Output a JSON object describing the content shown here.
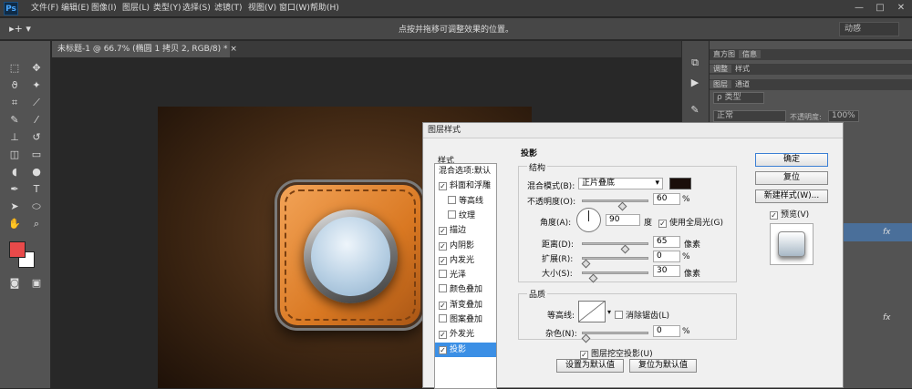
{
  "app": {
    "logo": "Ps"
  },
  "menubar": {
    "items": [
      "文件(F)",
      "编辑(E)",
      "图像(I)",
      "图层(L)",
      "类型(Y)",
      "选择(S)",
      "滤镜(T)",
      "视图(V)",
      "窗口(W)",
      "帮助(H)"
    ]
  },
  "window_controls": {
    "minimize": "—",
    "maximize": "□",
    "close": "✕"
  },
  "options_bar": {
    "hint": "点按并拖移可调整效果的位置。",
    "workspace": "动感"
  },
  "document_tab": {
    "label": "未标题-1 @ 66.7% (椭圆 1 拷贝 2, RGB/8) *",
    "close": "×"
  },
  "colors": {
    "foreground": "#e84a4a",
    "background": "#ffffff"
  },
  "panels": {
    "tabs_row1": [
      "直方图",
      "信息"
    ],
    "tabs_row2": [
      "调整",
      "样式"
    ],
    "tabs_row3": [
      "图层",
      "通道"
    ],
    "layer_filter": "ρ 类型",
    "blend_mode": "正常",
    "opacity_label": "不透明度:",
    "opacity_value": "100%",
    "fx_label": "fx"
  },
  "dialog": {
    "title": "图层样式",
    "styles_header": "样式",
    "style_items": [
      {
        "label": "混合选项:默认",
        "checkbox": false,
        "checked": false,
        "indent": false
      },
      {
        "label": "斜面和浮雕",
        "checkbox": true,
        "checked": true,
        "indent": false
      },
      {
        "label": "等高线",
        "checkbox": true,
        "checked": false,
        "indent": true
      },
      {
        "label": "纹理",
        "checkbox": true,
        "checked": false,
        "indent": true
      },
      {
        "label": "描边",
        "checkbox": true,
        "checked": true,
        "indent": false
      },
      {
        "label": "内阴影",
        "checkbox": true,
        "checked": true,
        "indent": false
      },
      {
        "label": "内发光",
        "checkbox": true,
        "checked": true,
        "indent": false
      },
      {
        "label": "光泽",
        "checkbox": true,
        "checked": false,
        "indent": false
      },
      {
        "label": "颜色叠加",
        "checkbox": true,
        "checked": false,
        "indent": false
      },
      {
        "label": "渐变叠加",
        "checkbox": true,
        "checked": true,
        "indent": false
      },
      {
        "label": "图案叠加",
        "checkbox": true,
        "checked": false,
        "indent": false
      },
      {
        "label": "外发光",
        "checkbox": true,
        "checked": true,
        "indent": false
      },
      {
        "label": "投影",
        "checkbox": true,
        "checked": true,
        "indent": false,
        "selected": true
      }
    ],
    "section_title": "投影",
    "structure": {
      "title": "结构",
      "blend_label": "混合模式(B):",
      "blend_value": "正片叠底",
      "shadow_color": "#1a0e0a",
      "opacity_label": "不透明度(O):",
      "opacity_value": "60",
      "opacity_fraction": 0.6,
      "angle_label": "角度(A):",
      "angle_value": "90",
      "angle_unit": "度",
      "global_light_label": "使用全局光(G)",
      "distance_label": "距离(D):",
      "distance_value": "65",
      "distance_fraction": 0.65,
      "spread_label": "扩展(R):",
      "spread_value": "0",
      "spread_fraction": 0,
      "size_label": "大小(S):",
      "size_value": "30",
      "size_fraction": 0.12,
      "percent": "%",
      "pixels": "像素"
    },
    "quality": {
      "title": "品质",
      "contour_label": "等高线:",
      "antialias_label": "消除锯齿(L)",
      "noise_label": "杂色(N):",
      "noise_value": "0",
      "noise_fraction": 0,
      "percent": "%"
    },
    "knockout_label": "图层挖空投影(U)",
    "make_default": "设置为默认值",
    "reset_default": "复位为默认值",
    "buttons": {
      "ok": "确定",
      "reset": "复位",
      "new_style": "新建样式(W)...",
      "preview": "预览(V)"
    }
  }
}
